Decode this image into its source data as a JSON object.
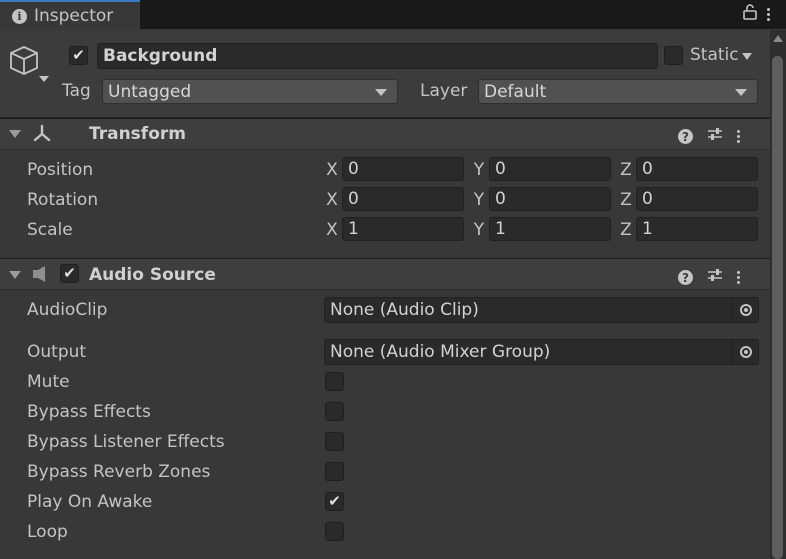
{
  "window": {
    "tab_title": "Inspector"
  },
  "gameobject": {
    "active": true,
    "name": "Background",
    "static_label": "Static",
    "tag_label": "Tag",
    "tag_value": "Untagged",
    "layer_label": "Layer",
    "layer_value": "Default"
  },
  "transform": {
    "title": "Transform",
    "rows": [
      {
        "label": "Position",
        "x": "0",
        "y": "0",
        "z": "0"
      },
      {
        "label": "Rotation",
        "x": "0",
        "y": "0",
        "z": "0"
      },
      {
        "label": "Scale",
        "x": "1",
        "y": "1",
        "z": "1"
      }
    ],
    "axes": {
      "x": "X",
      "y": "Y",
      "z": "Z"
    }
  },
  "audio_source": {
    "title": "Audio Source",
    "enabled": true,
    "audioclip_label": "AudioClip",
    "audioclip_value": "None (Audio Clip)",
    "output_label": "Output",
    "output_value": "None (Audio Mixer Group)",
    "toggles": [
      {
        "label": "Mute",
        "checked": false
      },
      {
        "label": "Bypass Effects",
        "checked": false
      },
      {
        "label": "Bypass Listener Effects",
        "checked": false
      },
      {
        "label": "Bypass Reverb Zones",
        "checked": false
      },
      {
        "label": "Play On Awake",
        "checked": true
      },
      {
        "label": "Loop",
        "checked": false
      }
    ]
  },
  "icons": {
    "tab": "info-icon",
    "lock": "lock-icon",
    "menu": "kebab-menu-icon",
    "gameobject": "cube-icon",
    "transform": "transform-axes-icon",
    "audio": "speaker-icon",
    "help": "help-icon",
    "presets": "presets-icon"
  },
  "colors": {
    "background": "#383838",
    "tab_accent": "#3a79bb",
    "field": "#2a2a2a",
    "text": "#c4c4c4"
  }
}
